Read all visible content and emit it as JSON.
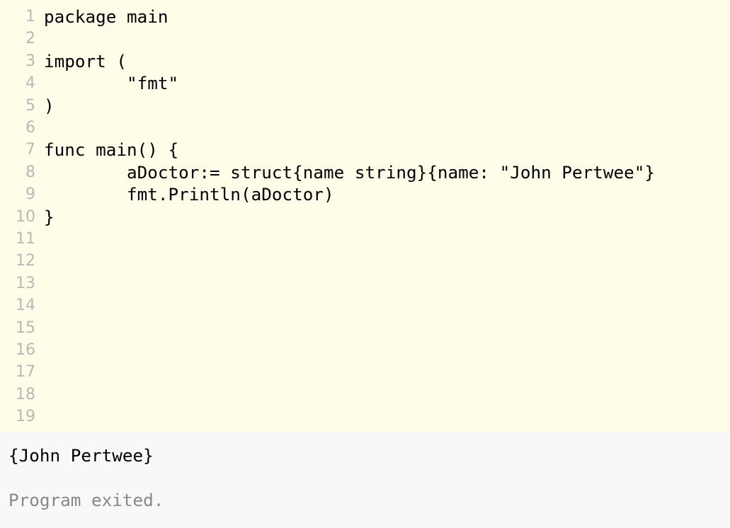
{
  "editor": {
    "background": "#fffde7",
    "lines": [
      {
        "num": "1",
        "text": "package main"
      },
      {
        "num": "2",
        "text": ""
      },
      {
        "num": "3",
        "text": "import ("
      },
      {
        "num": "4",
        "text": "\t\"fmt\""
      },
      {
        "num": "5",
        "text": ")"
      },
      {
        "num": "6",
        "text": ""
      },
      {
        "num": "7",
        "text": "func main() {"
      },
      {
        "num": "8",
        "text": "\taDoctor:= struct{name string}{name: \"John Pertwee\"}"
      },
      {
        "num": "9",
        "text": "\tfmt.Println(aDoctor)"
      },
      {
        "num": "10",
        "text": "}"
      },
      {
        "num": "11",
        "text": ""
      },
      {
        "num": "12",
        "text": ""
      },
      {
        "num": "13",
        "text": ""
      },
      {
        "num": "14",
        "text": ""
      },
      {
        "num": "15",
        "text": ""
      },
      {
        "num": "16",
        "text": ""
      },
      {
        "num": "17",
        "text": ""
      },
      {
        "num": "18",
        "text": ""
      },
      {
        "num": "19",
        "text": ""
      }
    ]
  },
  "output": {
    "result": "{John Pertwee}",
    "status": "Program exited."
  }
}
